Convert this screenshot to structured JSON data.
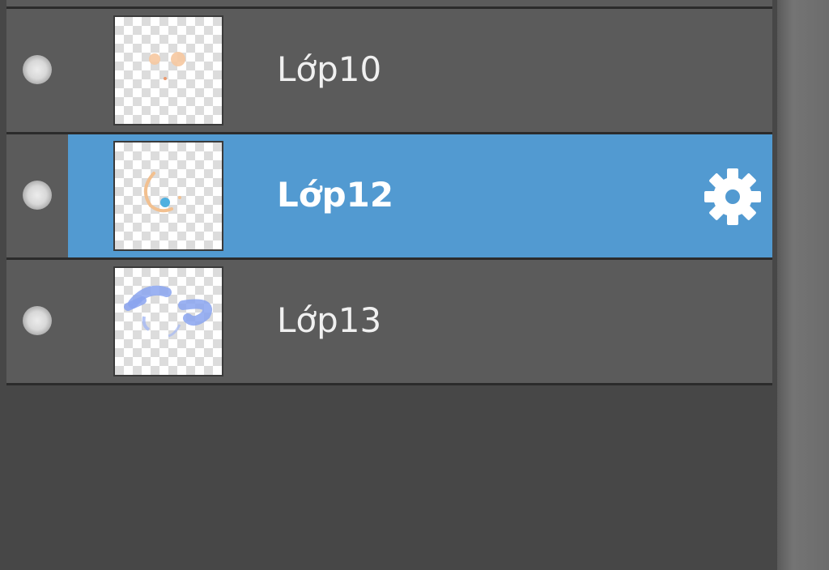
{
  "layers": [
    {
      "name": "Lớp10",
      "visible": true,
      "selected": false,
      "thumbnail": "peach-dots"
    },
    {
      "name": "Lớp12",
      "visible": true,
      "selected": true,
      "thumbnail": "arc-with-blue-dot",
      "options_icon": "gear-icon"
    },
    {
      "name": "Lớp13",
      "visible": true,
      "selected": false,
      "thumbnail": "blue-strokes"
    }
  ],
  "colors": {
    "panel_bg": "#474747",
    "row_bg": "#5b5b5b",
    "row_divider": "#2b2b2b",
    "selected_bg": "#529ad1",
    "text": "#f0f0f0"
  }
}
